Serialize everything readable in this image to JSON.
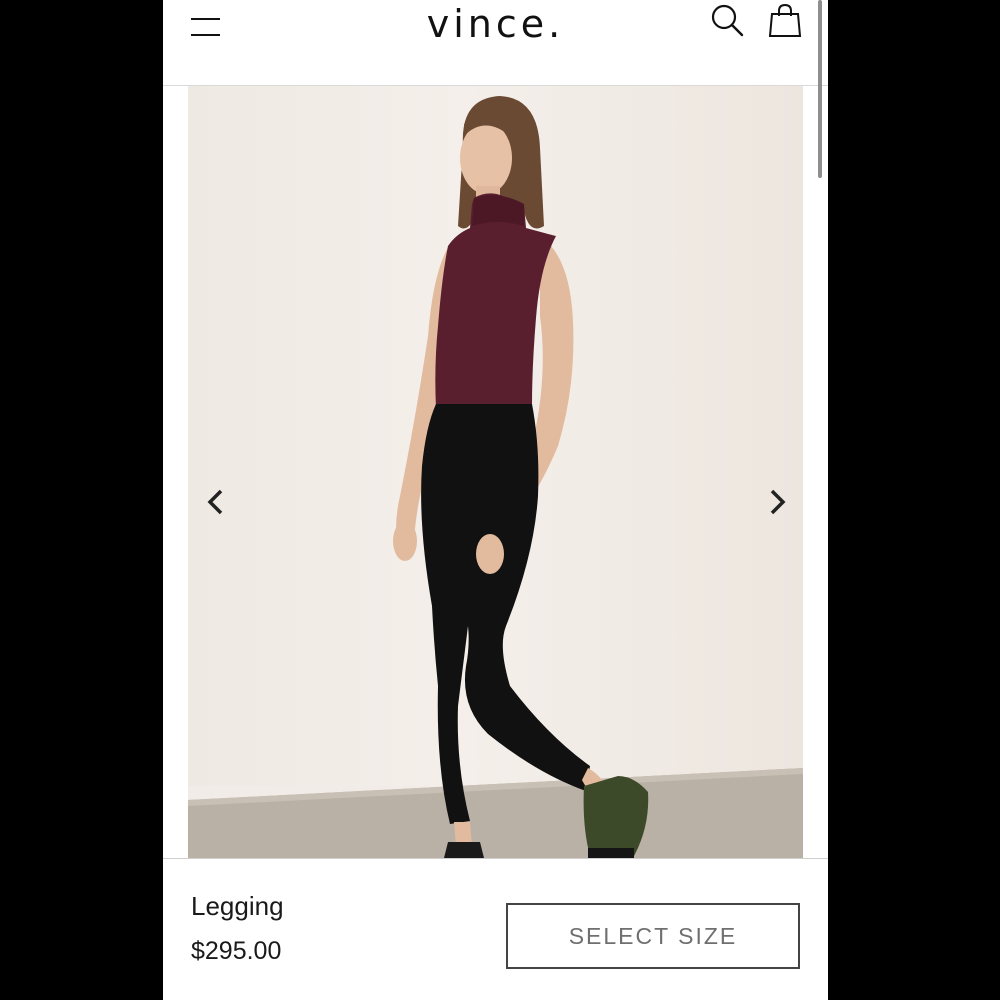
{
  "header": {
    "brand": "vince.",
    "icons": {
      "menu": "hamburger-menu-icon",
      "search": "search-icon",
      "bag": "shopping-bag-icon"
    }
  },
  "carousel": {
    "image": "model-legging-photo",
    "prev_icon": "chevron-left-icon",
    "next_icon": "chevron-right-icon"
  },
  "product": {
    "name": "Legging",
    "price": "$295.00",
    "select_size_label": "SELECT SIZE"
  },
  "colors": {
    "background": "#000000",
    "page": "#ffffff",
    "text": "#1a1a1a",
    "button_text": "#6f6f6f",
    "button_border": "#444444",
    "photo_wall": "#f1ece7",
    "top_color": "#5a1f2e",
    "legging_color": "#111111",
    "shoe_color": "#3d4a2a"
  }
}
